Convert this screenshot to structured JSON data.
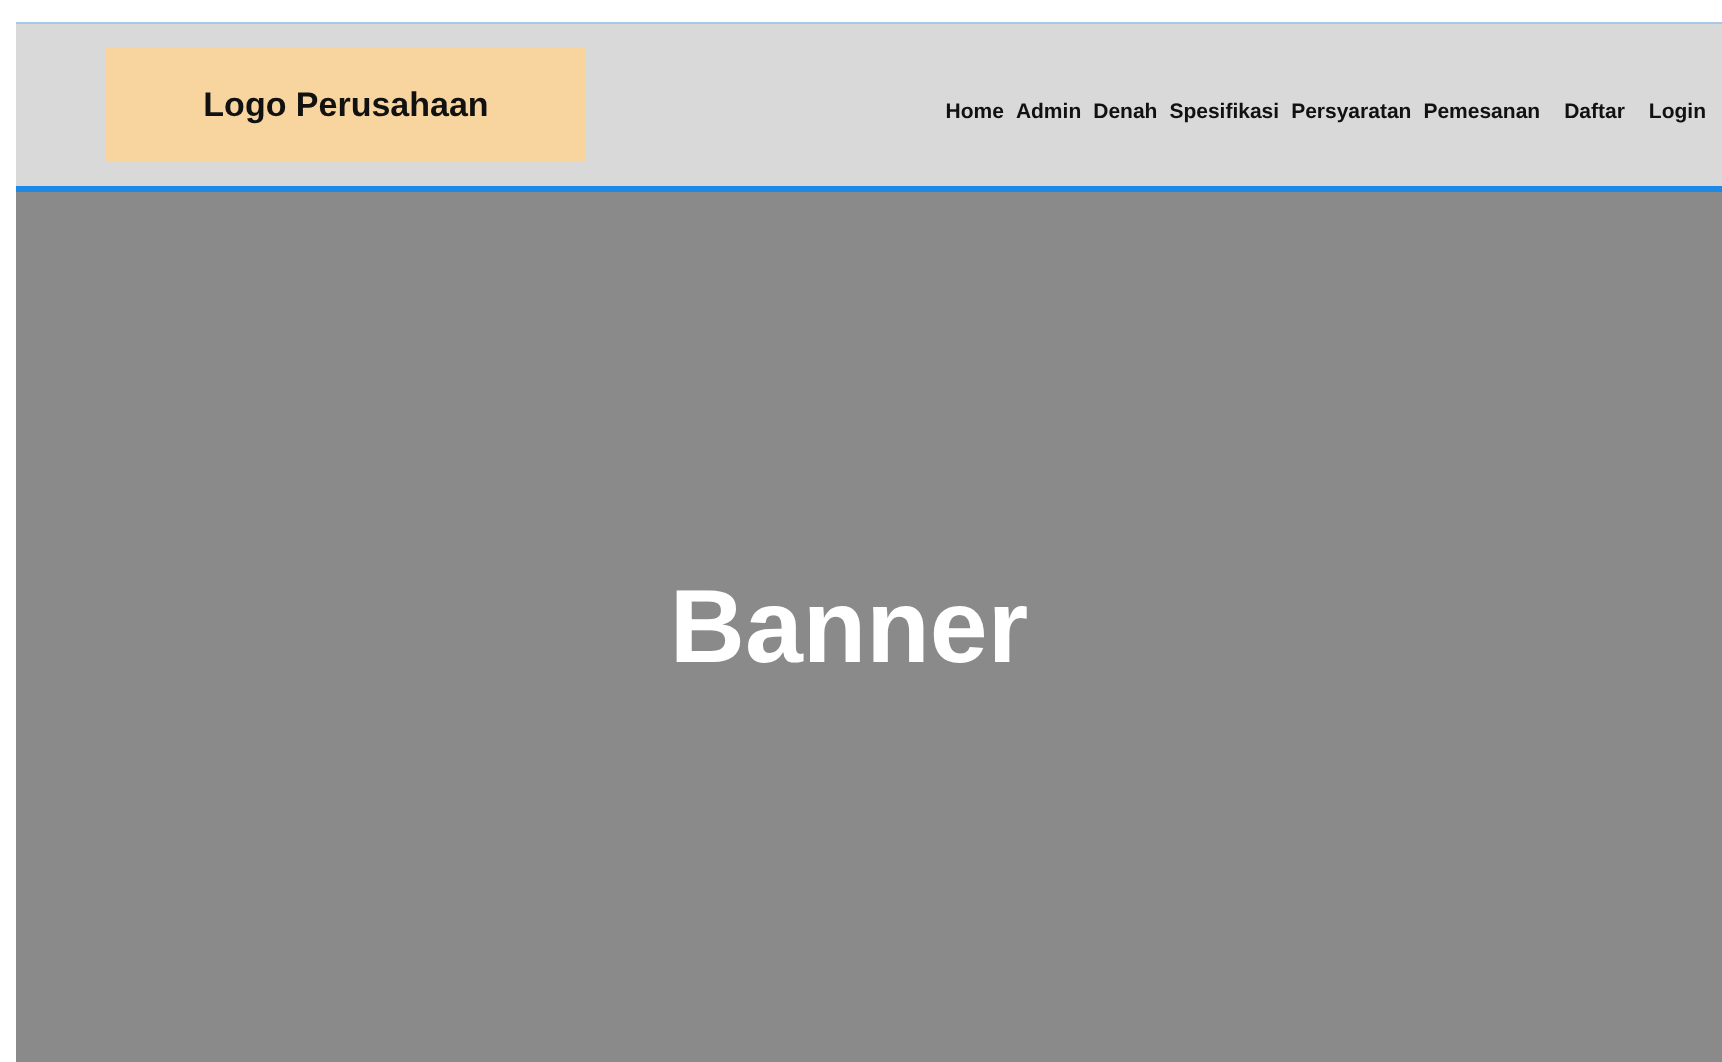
{
  "header": {
    "logo": "Logo Perusahaan",
    "nav": [
      "Home",
      "Admin",
      "Denah",
      "Spesifikasi",
      "Persyaratan",
      "Pemesanan",
      "Daftar",
      "Login"
    ]
  },
  "banner": {
    "title": "Banner"
  }
}
